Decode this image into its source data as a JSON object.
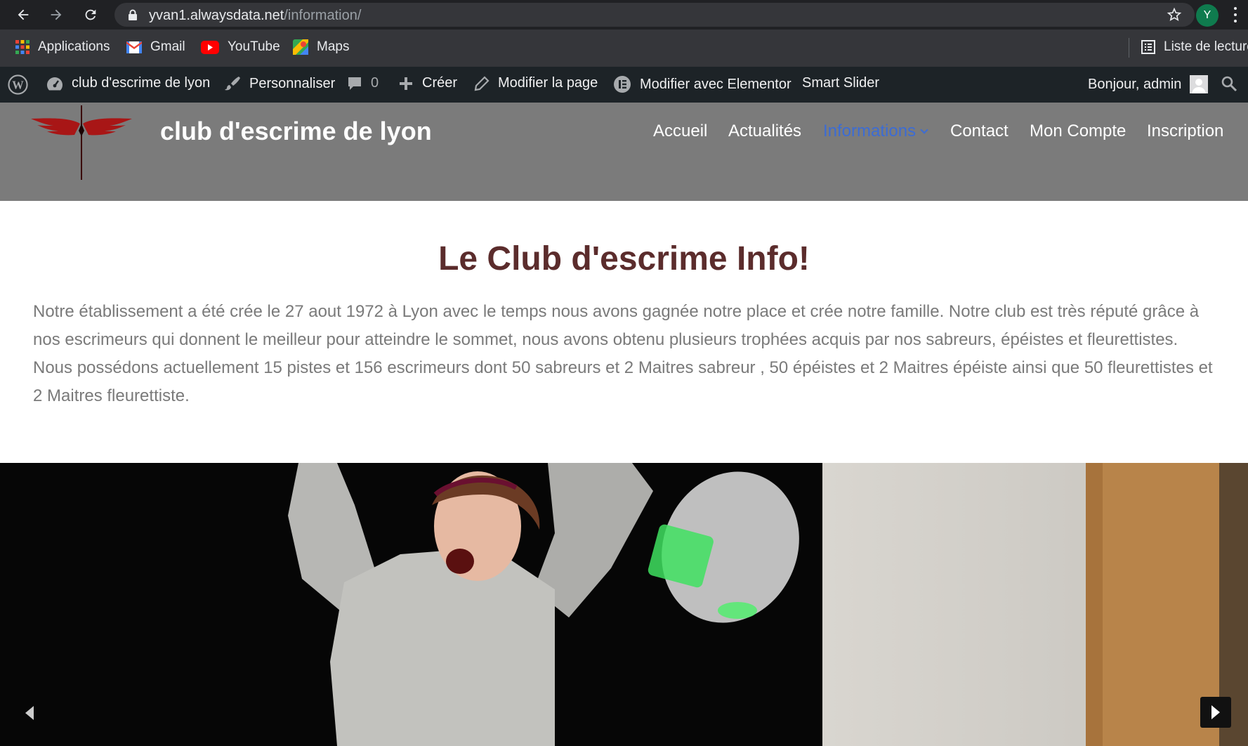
{
  "browser": {
    "url_host": "yvan1.alwaysdata.net",
    "url_path": "/information/",
    "profile_initial": "Y",
    "bookmarks": [
      {
        "label": "Applications",
        "icon": "apps-grid-icon"
      },
      {
        "label": "Gmail",
        "icon": "gmail-icon"
      },
      {
        "label": "YouTube",
        "icon": "youtube-icon"
      },
      {
        "label": "Maps",
        "icon": "maps-icon"
      }
    ],
    "reading_list": "Liste de lecture"
  },
  "admin_bar": {
    "site_name": "club d'escrime de lyon",
    "customize": "Personnaliser",
    "comments_count": "0",
    "new": "Créer",
    "edit_page": "Modifier la page",
    "edit_elementor": "Modifier avec Elementor",
    "smart_slider": "Smart Slider",
    "greeting": "Bonjour, admin"
  },
  "site": {
    "title": "club d'escrime de lyon",
    "menu": [
      {
        "label": "Accueil"
      },
      {
        "label": "Actualités"
      },
      {
        "label": "Informations",
        "active": true
      },
      {
        "label": "Contact"
      },
      {
        "label": "Mon Compte"
      },
      {
        "label": "Inscription"
      }
    ]
  },
  "content": {
    "heading": "Le Club d'escrime Info!",
    "paragraph": "Notre établissement a été crée le 27 aout 1972 à Lyon avec le temps nous avons gagnée notre place et crée notre famille. Notre club est très réputé grâce à nos escrimeurs qui donnent le meilleur pour atteindre le sommet, nous avons obtenu plusieurs trophées acquis par nos sabreurs, épéistes et fleurettistes. Nous possédons actuellement 15 pistes et 156 escrimeurs dont 50 sabreurs et 2 Maitres sabreur , 50 épéistes et 2 Maitres épéiste ainsi que 50 fleurettistes et 2 Maitres fleurettiste."
  },
  "colors": {
    "header_bg": "#7b7b7b",
    "menu_active": "#3c6cd4",
    "heading": "#5b2c2c",
    "body_text": "#7a7a7a",
    "admin_bar": "#1d2327"
  }
}
